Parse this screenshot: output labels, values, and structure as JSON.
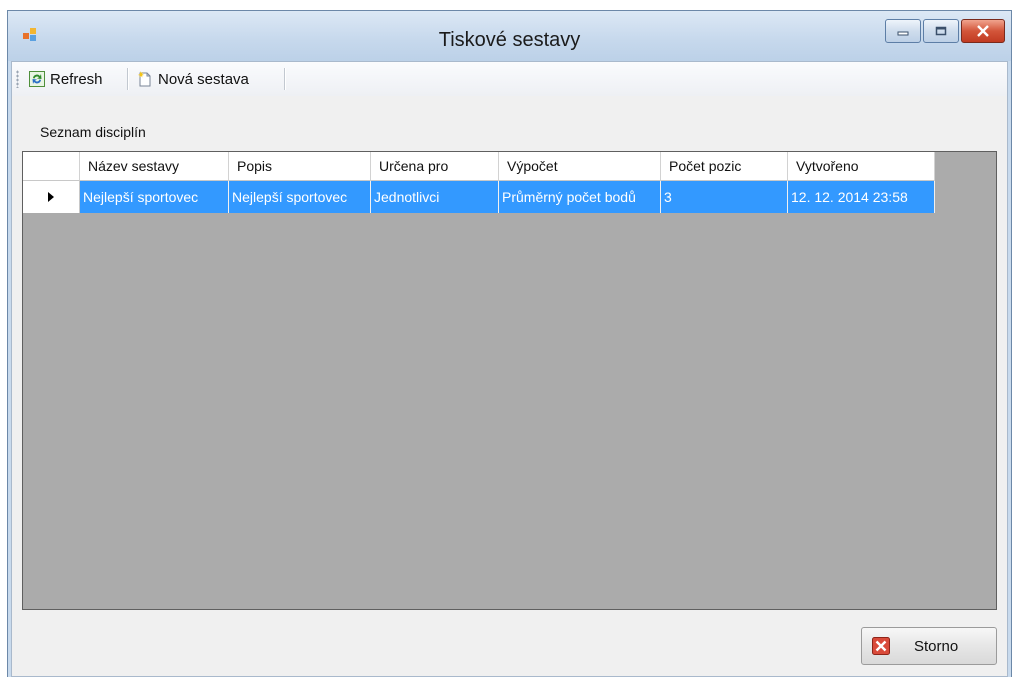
{
  "window": {
    "title": "Tiskové sestavy"
  },
  "toolbar": {
    "refresh_label": "Refresh",
    "new_report_label": "Nová sestava"
  },
  "section_label": "Seznam disciplín",
  "grid": {
    "columns": [
      "Název sestavy",
      "Popis",
      "Určena pro",
      "Výpočet",
      "Počet pozic",
      "Vytvořeno"
    ],
    "rows": [
      {
        "selected": true,
        "cells": [
          "Nejlepší sportovec",
          "Nejlepší sportovec",
          "Jednotlivci",
          "Průměrný počet bodů",
          "3",
          "12. 12. 2014 23:58"
        ]
      }
    ]
  },
  "buttons": {
    "cancel_label": "Storno"
  },
  "colors": {
    "selection": "#3399ff",
    "grid_background": "#ababab",
    "close_button": "#c13b22"
  }
}
